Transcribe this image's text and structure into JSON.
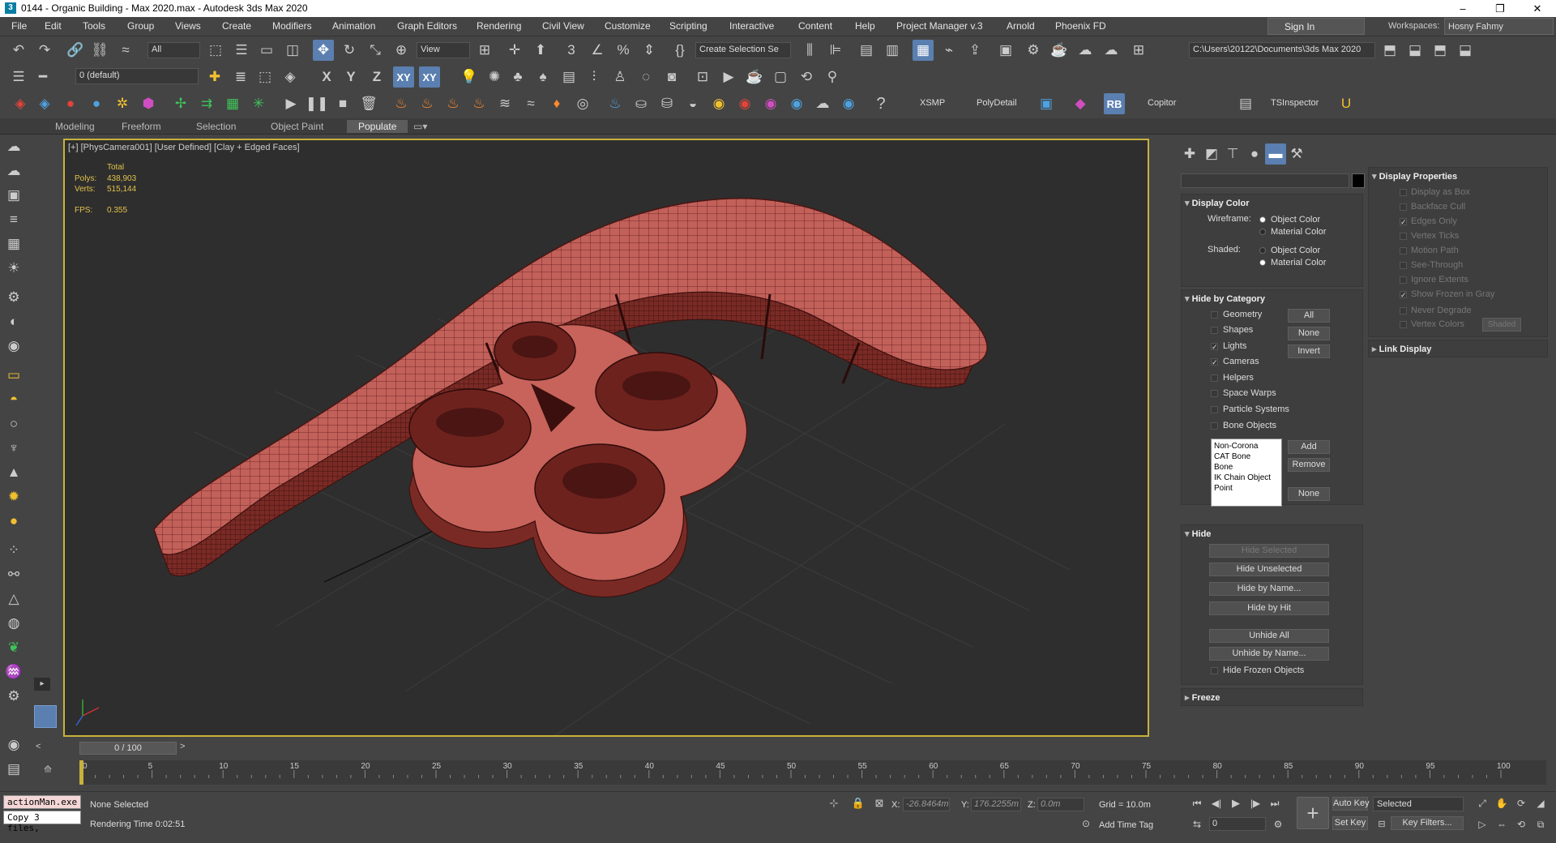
{
  "title": "0144 - Organic Building - Max 2020.max - Autodesk 3ds Max 2020",
  "window_controls": [
    "–",
    "❐",
    "✕"
  ],
  "menu": [
    "File",
    "Edit",
    "Tools",
    "Group",
    "Views",
    "Create",
    "Modifiers",
    "Animation",
    "Graph Editors",
    "Rendering",
    "Civil View",
    "Customize",
    "Scripting",
    "Interactive",
    "Content",
    "Help",
    "Project Manager v.3",
    "Arnold",
    "Phoenix FD"
  ],
  "sign_in": "Sign In",
  "workspaces_label": "Workspaces:",
  "workspace_value": "Hosny Fahmy",
  "toolbar1": {
    "selection_filter": "All",
    "ref_coord": "View",
    "named_selection": "Create Selection Se",
    "project_path": "C:\\Users\\20122\\Documents\\3ds Max 2020"
  },
  "toolbar2": {
    "layer": "0 (default)",
    "axis_x": "X",
    "axis_y": "Y",
    "axis_z": "Z",
    "axis_xy": "XY",
    "axis_xy2": "XY"
  },
  "toolbar3": {
    "xsmp": "XSMP",
    "polydetail": "PolyDetail",
    "rb": "RB",
    "copitor": "Copitor",
    "tsinspector": "TSInspector"
  },
  "ribbon_tabs": [
    "Modeling",
    "Freeform",
    "Selection",
    "Object Paint",
    "Populate"
  ],
  "viewport": {
    "label": "[+] [PhysCamera001] [User Defined] [Clay + Edged Faces]",
    "stats": {
      "total_label": "Total",
      "polys_label": "Polys:",
      "polys_value": "438,903",
      "verts_label": "Verts:",
      "verts_value": "515,144",
      "fps_label": "FPS:",
      "fps_value": "0.355"
    }
  },
  "display_color": {
    "title": "Display Color",
    "wireframe_label": "Wireframe:",
    "shaded_label": "Shaded:",
    "object_color": "Object Color",
    "material_color": "Material Color"
  },
  "hide_by_category": {
    "title": "Hide by Category",
    "items": [
      "Geometry",
      "Shapes",
      "Lights",
      "Cameras",
      "Helpers",
      "Space Warps",
      "Particle Systems",
      "Bone Objects"
    ],
    "checked": [
      false,
      false,
      true,
      true,
      false,
      false,
      false,
      false
    ],
    "all": "All",
    "none": "None",
    "invert": "Invert",
    "list": [
      "Non-Corona",
      "CAT Bone",
      "Bone",
      "IK Chain Object",
      "Point"
    ],
    "add": "Add",
    "remove": "Remove",
    "none2": "None"
  },
  "hide": {
    "title": "Hide",
    "hide_selected": "Hide Selected",
    "hide_unselected": "Hide Unselected",
    "hide_by_name": "Hide by Name...",
    "hide_by_hit": "Hide by Hit",
    "unhide_all": "Unhide All",
    "unhide_by_name": "Unhide by Name...",
    "hide_frozen": "Hide Frozen Objects"
  },
  "freeze": {
    "title": "Freeze"
  },
  "display_properties": {
    "title": "Display Properties",
    "items": [
      "Display as Box",
      "Backface Cull",
      "Edges Only",
      "Vertex Ticks",
      "Motion Path",
      "See-Through",
      "Ignore Extents",
      "Show Frozen in Gray",
      "Never Degrade",
      "Vertex Colors"
    ],
    "checked": [
      false,
      false,
      true,
      false,
      false,
      false,
      false,
      true,
      false,
      false
    ],
    "shaded_btn": "Shaded"
  },
  "link_display": {
    "title": "Link Display"
  },
  "timeline": {
    "slider": "0 / 100",
    "ticks": [
      "0",
      "5",
      "10",
      "15",
      "20",
      "25",
      "30",
      "35",
      "40",
      "45",
      "50",
      "55",
      "60",
      "65",
      "70",
      "75",
      "80",
      "85",
      "90",
      "95",
      "100"
    ]
  },
  "status": {
    "maxscript_line1": "actionMan.exe",
    "maxscript_line2": "Copy 3 files,",
    "selection": "None Selected",
    "render_time": "Rendering Time  0:02:51",
    "x_label": "X:",
    "x_value": "-26.8464m",
    "y_label": "Y:",
    "y_value": "176.2255m",
    "z_label": "Z:",
    "z_value": "0.0m",
    "grid": "Grid = 10.0m",
    "add_time_tag": "Add Time Tag",
    "auto_key": "Auto Key",
    "set_key": "Set Key",
    "selected": "Selected",
    "key_filters": "Key Filters...",
    "frame": "0"
  }
}
